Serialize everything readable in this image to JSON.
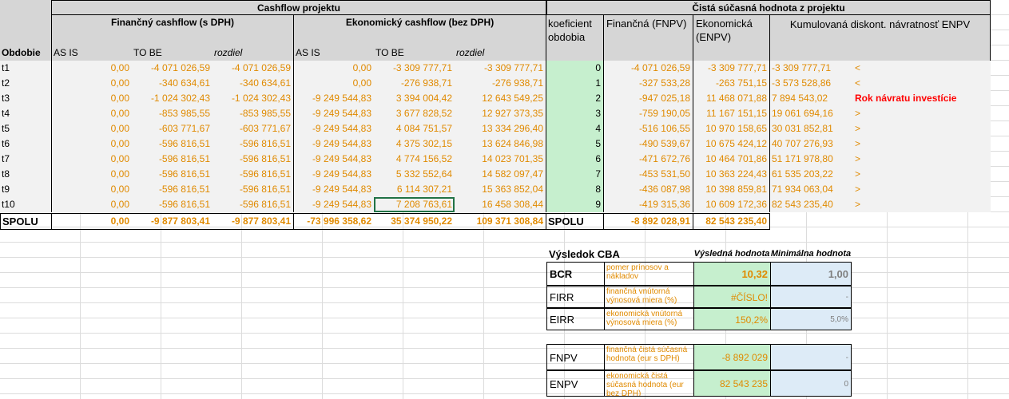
{
  "headers": {
    "cashflow_title": "Cashflow projektu",
    "npv_title": "Čistá súčasná hodnota z projektu",
    "fin_cf": "Finančný cashflow (s DPH)",
    "eco_cf": "Ekonomický cashflow (bez DPH)",
    "coef": "koeficient obdobia",
    "fnpv": "Finančná (FNPV)",
    "enpv": "Ekonomická (ENPV)",
    "cum": "Kumulovaná diskont. návratnosť ENPV",
    "obdobie": "Obdobie",
    "as_is": "AS IS",
    "to_be": "TO BE",
    "rozdiel": "rozdiel",
    "as_is2": "AS IS",
    "to_be2": "TO BE",
    "rozdiel2": "rozdiel"
  },
  "rows": [
    {
      "period": "t1",
      "f_asis": "0,00",
      "f_tobe": "-4 071 026,59",
      "f_diff": "-4 071 026,59",
      "e_asis": "0,00",
      "e_tobe": "-3 309 777,71",
      "e_diff": "-3 309 777,71",
      "coef": "0",
      "fnpv": "-4 071 026,59",
      "enpv": "-3 309 777,71",
      "cum": "-3 309 777,71",
      "mark": "<"
    },
    {
      "period": "t2",
      "f_asis": "0,00",
      "f_tobe": "-340 634,61",
      "f_diff": "-340 634,61",
      "e_asis": "0,00",
      "e_tobe": "-276 938,71",
      "e_diff": "-276 938,71",
      "coef": "1",
      "fnpv": "-327 533,28",
      "enpv": "-263 751,15",
      "cum": "-3 573 528,86",
      "mark": "<"
    },
    {
      "period": "t3",
      "f_asis": "0,00",
      "f_tobe": "-1 024 302,43",
      "f_diff": "-1 024 302,43",
      "e_asis": "-9 249 544,83",
      "e_tobe": "3 394 004,42",
      "e_diff": "12 643 549,25",
      "coef": "2",
      "fnpv": "-947 025,18",
      "enpv": "11 468 071,88",
      "cum": "7 894 543,02",
      "mark": "Rok návratu investície"
    },
    {
      "period": "t4",
      "f_asis": "0,00",
      "f_tobe": "-853 985,55",
      "f_diff": "-853 985,55",
      "e_asis": "-9 249 544,83",
      "e_tobe": "3 677 828,52",
      "e_diff": "12 927 373,35",
      "coef": "3",
      "fnpv": "-759 190,05",
      "enpv": "11 167 151,15",
      "cum": "19 061 694,16",
      "mark": ">"
    },
    {
      "period": "t5",
      "f_asis": "0,00",
      "f_tobe": "-603 771,67",
      "f_diff": "-603 771,67",
      "e_asis": "-9 249 544,83",
      "e_tobe": "4 084 751,57",
      "e_diff": "13 334 296,40",
      "coef": "4",
      "fnpv": "-516 106,55",
      "enpv": "10 970 158,65",
      "cum": "30 031 852,81",
      "mark": ">"
    },
    {
      "period": "t6",
      "f_asis": "0,00",
      "f_tobe": "-596 816,51",
      "f_diff": "-596 816,51",
      "e_asis": "-9 249 544,83",
      "e_tobe": "4 375 302,15",
      "e_diff": "13 624 846,98",
      "coef": "5",
      "fnpv": "-490 539,67",
      "enpv": "10 675 424,12",
      "cum": "40 707 276,93",
      "mark": ">"
    },
    {
      "period": "t7",
      "f_asis": "0,00",
      "f_tobe": "-596 816,51",
      "f_diff": "-596 816,51",
      "e_asis": "-9 249 544,83",
      "e_tobe": "4 774 156,52",
      "e_diff": "14 023 701,35",
      "coef": "6",
      "fnpv": "-471 672,76",
      "enpv": "10 464 701,86",
      "cum": "51 171 978,80",
      "mark": ">"
    },
    {
      "period": "t8",
      "f_asis": "0,00",
      "f_tobe": "-596 816,51",
      "f_diff": "-596 816,51",
      "e_asis": "-9 249 544,83",
      "e_tobe": "5 332 552,64",
      "e_diff": "14 582 097,47",
      "coef": "7",
      "fnpv": "-453 531,50",
      "enpv": "10 363 224,43",
      "cum": "61 535 203,22",
      "mark": ">"
    },
    {
      "period": "t9",
      "f_asis": "0,00",
      "f_tobe": "-596 816,51",
      "f_diff": "-596 816,51",
      "e_asis": "-9 249 544,83",
      "e_tobe": "6 114 307,21",
      "e_diff": "15 363 852,04",
      "coef": "8",
      "fnpv": "-436 087,98",
      "enpv": "10 398 859,81",
      "cum": "71 934 063,04",
      "mark": ">"
    },
    {
      "period": "t10",
      "f_asis": "0,00",
      "f_tobe": "-596 816,51",
      "f_diff": "-596 816,51",
      "e_asis": "-9 249 544,83",
      "e_tobe": "7 208 763,61",
      "e_diff": "16 458 308,44",
      "coef": "9",
      "fnpv": "-419 315,36",
      "enpv": "10 609 172,36",
      "cum": "82 543 235,40",
      "mark": ">"
    }
  ],
  "totals": {
    "label": "SPOLU",
    "f_asis": "0,00",
    "f_tobe": "-9 877 803,41",
    "f_diff": "-9 877 803,41",
    "e_asis": "-73 996 358,62",
    "e_tobe": "35 374 950,22",
    "e_diff": "109 371 308,84",
    "label2": "SPOLU",
    "fnpv": "-8 892 028,91",
    "enpv": "82 543 235,40"
  },
  "cba": {
    "title": "Výsledok CBA",
    "col_result": "Výsledná hodnota",
    "col_min": "Minimálna hodnota",
    "rows": [
      {
        "name": "BCR",
        "desc": "pomer prínosov a nákladov",
        "result": "10,32",
        "min": "1,00"
      },
      {
        "name": "FIRR",
        "desc": "finančná vnútorná výnosová miera (%)",
        "result": "#ČÍSLO!",
        "min": "-"
      },
      {
        "name": "EIRR",
        "desc": "ekonomická vnútorná výnosová miera (%)",
        "result": "150,2%",
        "min": "5,0%"
      }
    ],
    "rows2": [
      {
        "name": "FNPV",
        "desc": "finančná čistá súčasná hodnota (eur s DPH)",
        "result": "-8 892 029",
        "min": "-"
      },
      {
        "name": "ENPV",
        "desc": "ekonomická čistá súčasná hodnota (eur bez DPH)",
        "result": "82 543 235",
        "min": "0"
      }
    ]
  }
}
